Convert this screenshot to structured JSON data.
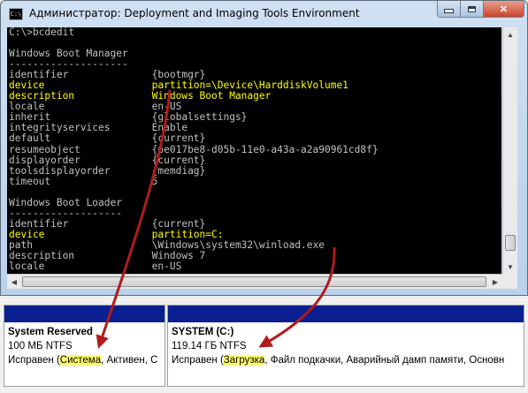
{
  "window": {
    "title": "Администратор: Deployment and Imaging Tools Environment",
    "icon_text": "C:\\"
  },
  "console": {
    "prompt": "C:\\>bcdedit",
    "sections": [
      {
        "header": "Windows Boot Manager",
        "rows": [
          {
            "key": "identifier",
            "value": "{bootmgr}",
            "highlight": false
          },
          {
            "key": "device",
            "value": "partition=\\Device\\HarddiskVolume1",
            "highlight": true
          },
          {
            "key": "description",
            "value": "Windows Boot Manager",
            "highlight": true
          },
          {
            "key": "locale",
            "value": "en-US",
            "highlight": false
          },
          {
            "key": "inherit",
            "value": "{globalsettings}",
            "highlight": false
          },
          {
            "key": "integrityservices",
            "value": "Enable",
            "highlight": false
          },
          {
            "key": "default",
            "value": "{current}",
            "highlight": false
          },
          {
            "key": "resumeobject",
            "value": "{6e017be8-d05b-11e0-a43a-a2a90961cd8f}",
            "highlight": false
          },
          {
            "key": "displayorder",
            "value": "{current}",
            "highlight": false
          },
          {
            "key": "toolsdisplayorder",
            "value": "{memdiag}",
            "highlight": false
          },
          {
            "key": "timeout",
            "value": "5",
            "highlight": false
          }
        ]
      },
      {
        "header": "Windows Boot Loader",
        "rows": [
          {
            "key": "identifier",
            "value": "{current}",
            "highlight": false
          },
          {
            "key": "device",
            "value": "partition=C:",
            "highlight": true
          },
          {
            "key": "path",
            "value": "\\Windows\\system32\\winload.exe",
            "highlight": false
          },
          {
            "key": "description",
            "value": "Windows 7",
            "highlight": false
          },
          {
            "key": "locale",
            "value": "en-US",
            "highlight": false
          }
        ]
      }
    ]
  },
  "partitions": [
    {
      "name": "System Reserved",
      "size": "100 МБ NTFS",
      "status_before": "Исправен (",
      "status_highlight": "Система",
      "status_after": ", Активен, С"
    },
    {
      "name": "SYSTEM  (C:)",
      "size": "119.14 ГБ NTFS",
      "status_before": "Исправен (",
      "status_highlight": "Загрузка",
      "status_after": ", Файл подкачки, Аварийный дамп памяти, Основн"
    }
  ],
  "colors": {
    "console_bg": "#000000",
    "console_text": "#c0c0c0",
    "console_highlight": "#ffff00",
    "partition_bar": "#0a1f8f",
    "arrow": "#b01c1c",
    "text_highlight": "#ffff66"
  }
}
